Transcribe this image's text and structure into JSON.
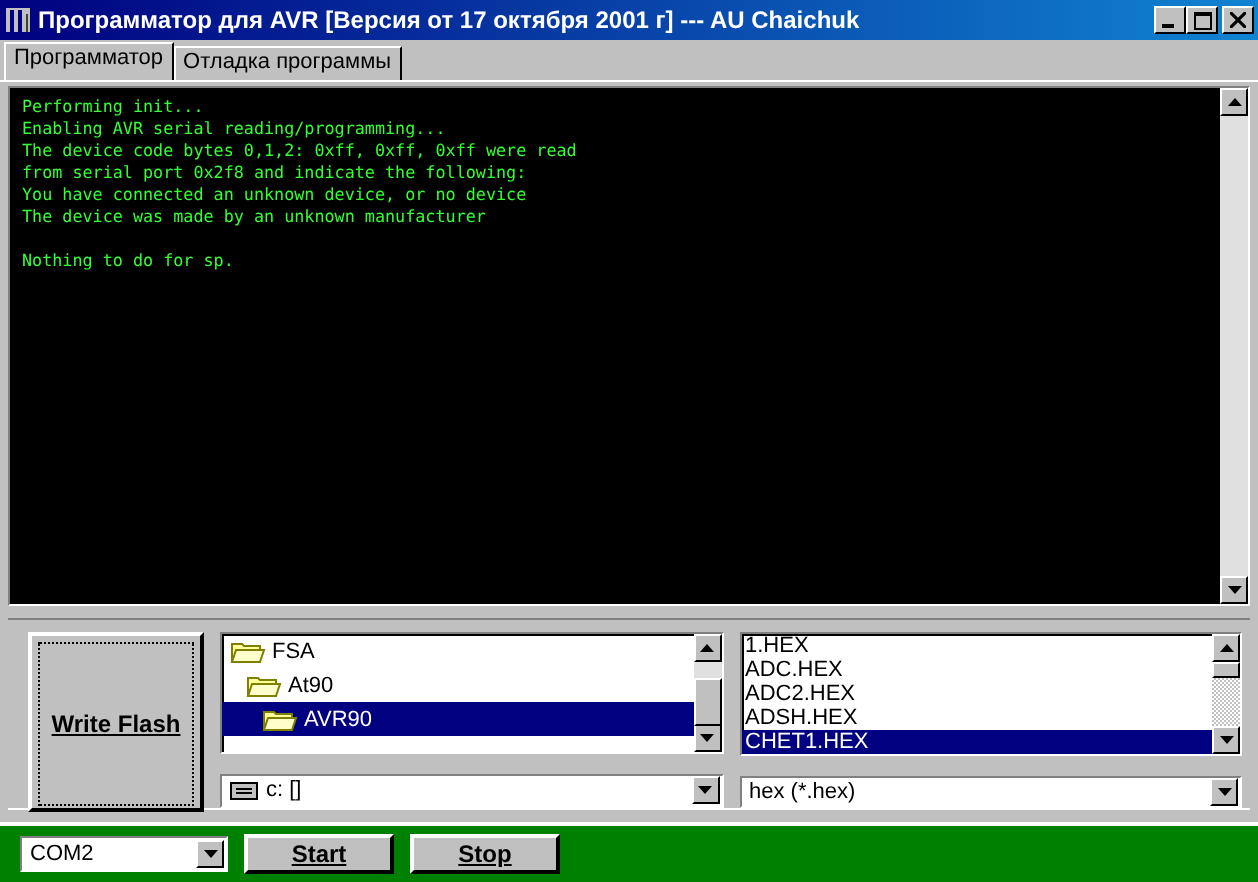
{
  "window": {
    "title": "Программатор для AVR [Версия от 17 октября 2001 г] --- AU Chaichuk"
  },
  "tabs": [
    {
      "label": "Программатор",
      "selected": true
    },
    {
      "label": "Отладка программы",
      "selected": false
    }
  ],
  "console": {
    "paragraphs": [
      [
        "Performing init...",
        "Enabling AVR serial reading/programming...",
        "The device code bytes 0,1,2: 0xff, 0xff, 0xff were read",
        "from serial port 0x2f8 and indicate the following:",
        "You have connected an unknown device, or no device",
        "The device was made by an unknown manufacturer"
      ],
      [
        "Nothing to do for sp."
      ]
    ]
  },
  "write_button": {
    "label": "Write Flash"
  },
  "folders": [
    {
      "name": "FSA",
      "selected": false,
      "children": [
        {
          "name": "At90",
          "selected": false,
          "children": [
            {
              "name": "AVR90",
              "selected": true
            }
          ]
        }
      ]
    }
  ],
  "drive": {
    "value": "c: []"
  },
  "files": [
    {
      "name": "1.HEX",
      "selected": false
    },
    {
      "name": "ADC.HEX",
      "selected": false
    },
    {
      "name": "ADC2.HEX",
      "selected": false
    },
    {
      "name": "ADSH.HEX",
      "selected": false
    },
    {
      "name": "CHET1.HEX",
      "selected": true
    }
  ],
  "filter": {
    "value": "hex (*.hex)"
  },
  "port": {
    "value": "COM2"
  },
  "buttons": [
    {
      "label": "Start"
    },
    {
      "label": "Stop"
    }
  ]
}
